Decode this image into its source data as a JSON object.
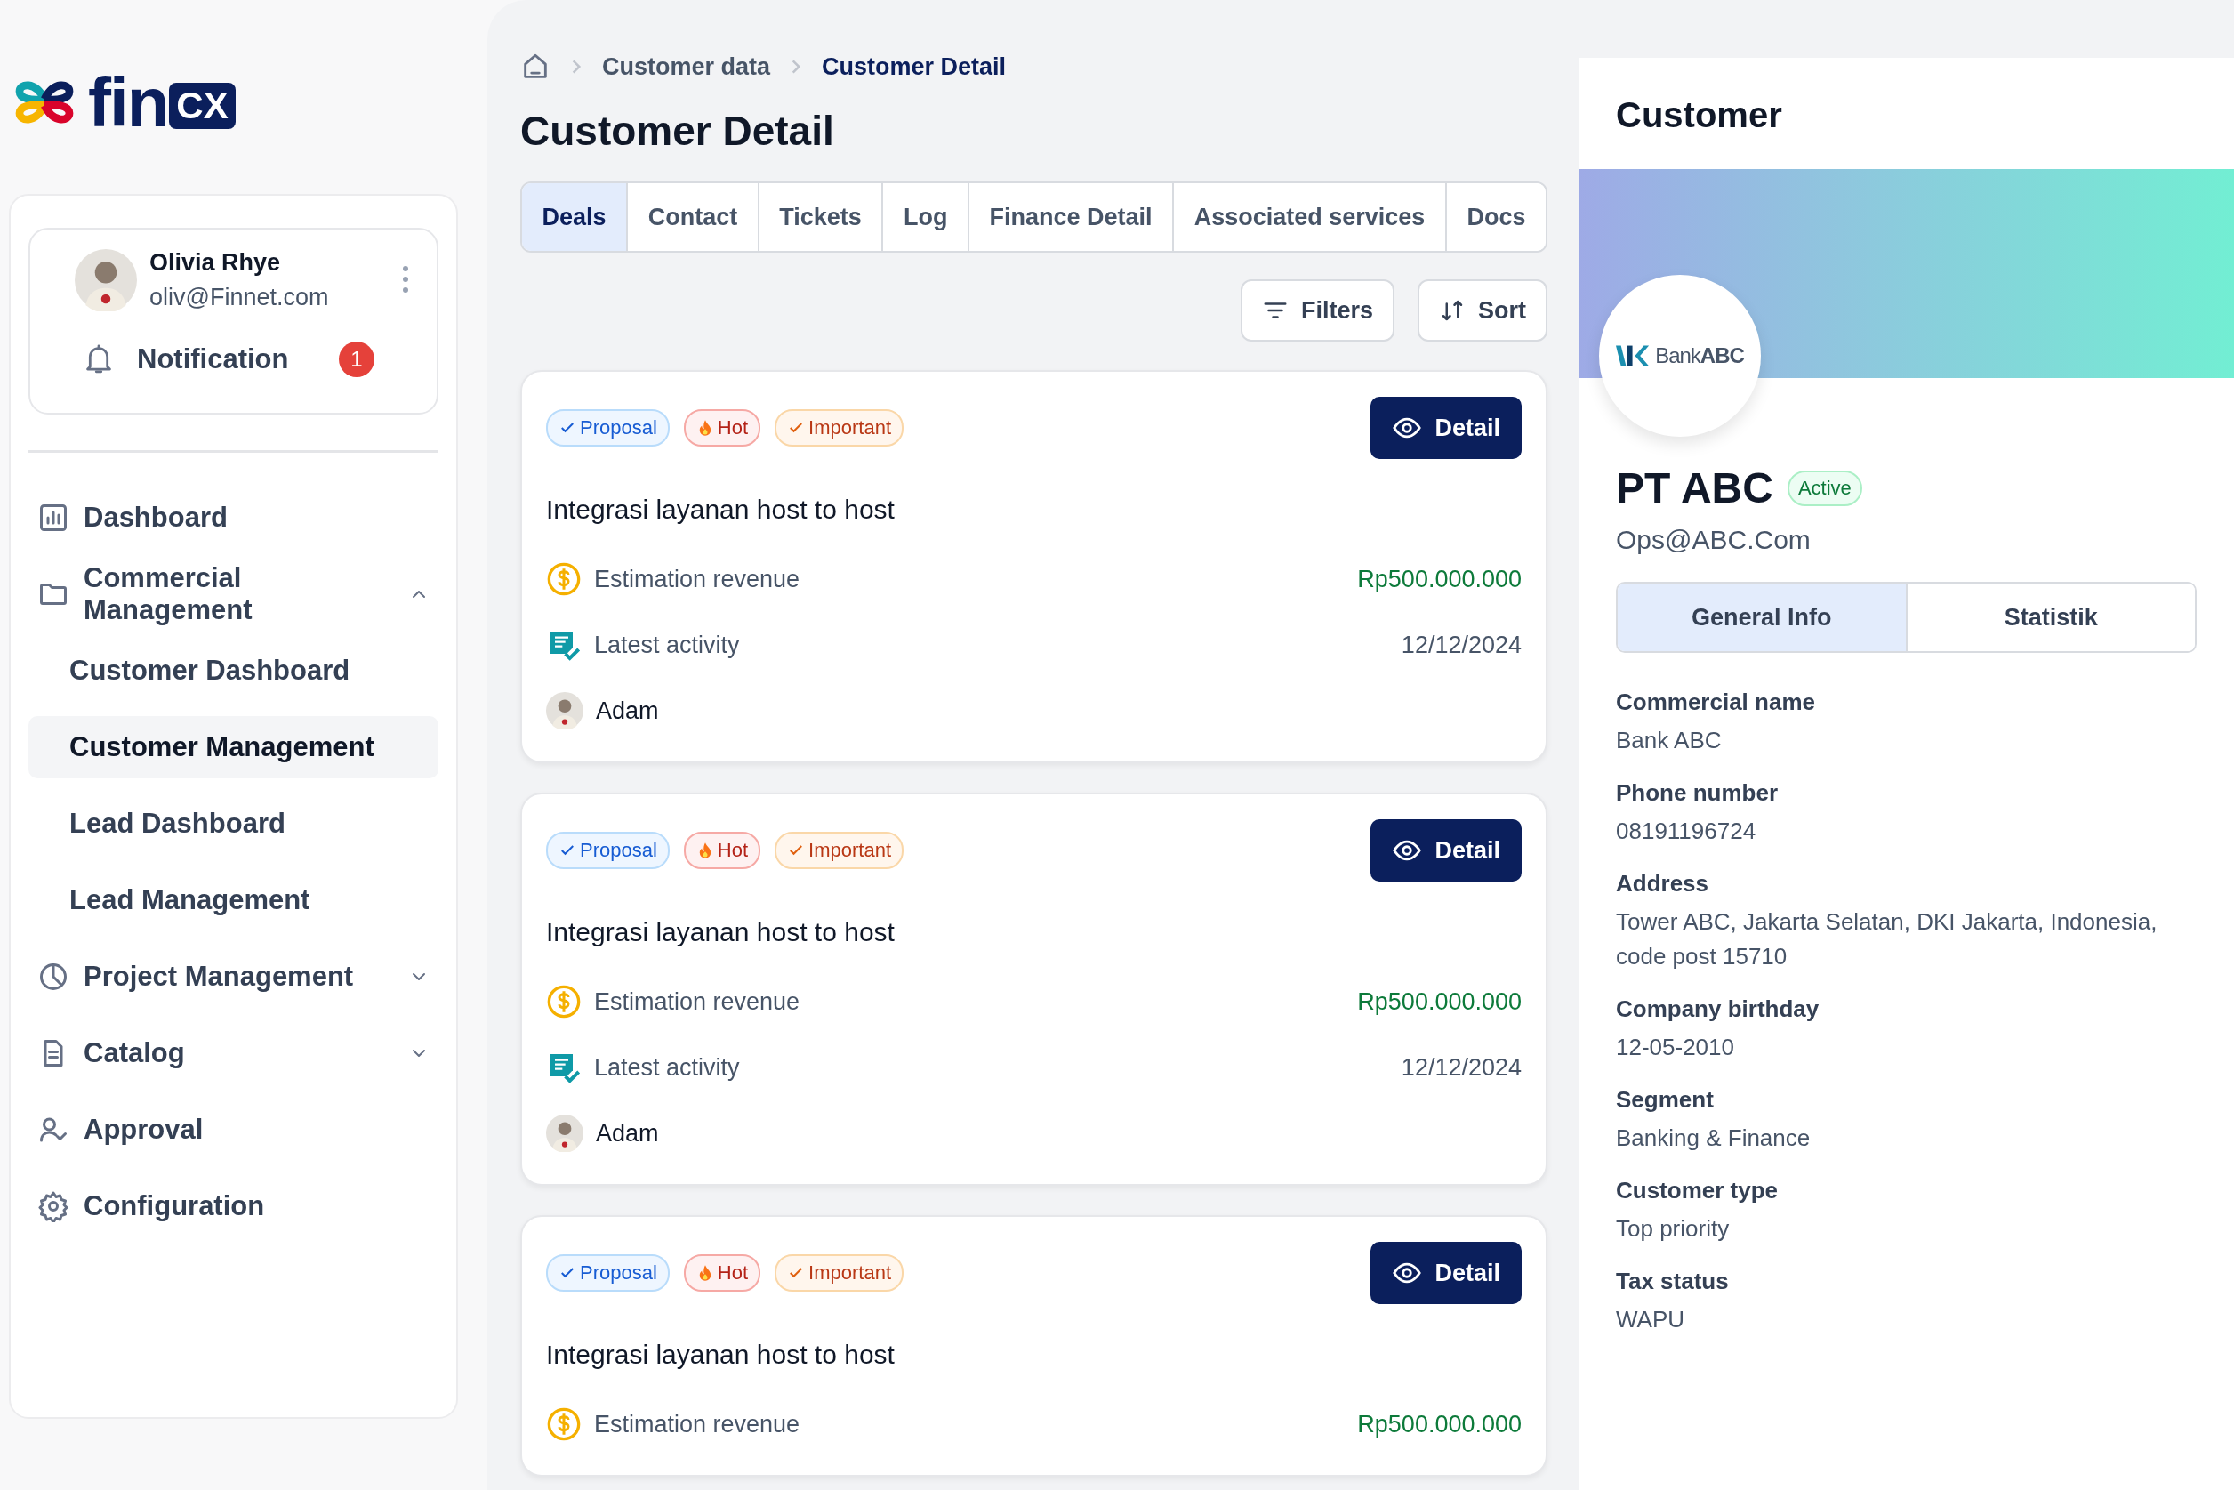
{
  "logo": {
    "text": "fin",
    "badge": "CX"
  },
  "user": {
    "name": "Olivia Rhye",
    "email": "oliv@Finnet.com"
  },
  "notification": {
    "label": "Notification",
    "count": "1"
  },
  "nav": [
    {
      "label": "Dashboard",
      "selected": false
    },
    {
      "label": "Commercial Management",
      "selected": false,
      "expanded": true,
      "children": [
        {
          "label": "Customer Dashboard",
          "selected": false
        },
        {
          "label": "Customer Management",
          "selected": true
        },
        {
          "label": "Lead Dashboard",
          "selected": false
        },
        {
          "label": "Lead Management",
          "selected": false
        }
      ]
    },
    {
      "label": "Project Management",
      "selected": false,
      "expanded": false
    },
    {
      "label": "Catalog",
      "selected": false,
      "expanded": false
    },
    {
      "label": "Approval",
      "selected": false
    },
    {
      "label": "Configuration",
      "selected": false
    }
  ],
  "breadcrumb": [
    {
      "label": "Customer data",
      "current": false
    },
    {
      "label": "Customer Detail",
      "current": true
    }
  ],
  "title": "Customer Detail",
  "tabs": [
    {
      "label": "Deals",
      "selected": true
    },
    {
      "label": "Contact",
      "selected": false
    },
    {
      "label": "Tickets",
      "selected": false
    },
    {
      "label": "Log",
      "selected": false
    },
    {
      "label": "Finance Detail",
      "selected": false
    },
    {
      "label": "Associated services",
      "selected": false
    },
    {
      "label": "Docs",
      "selected": false
    }
  ],
  "toolbar": [
    {
      "kind": "filter",
      "label": "Filters"
    },
    {
      "kind": "sort",
      "label": "Sort"
    }
  ],
  "deals": [
    {
      "tags": [
        {
          "kind": "proposal",
          "label": "Proposal"
        },
        {
          "kind": "hot",
          "label": "Hot"
        },
        {
          "kind": "important",
          "label": "Important"
        }
      ],
      "action": "Detail",
      "title": "Integrasi layanan host to host",
      "revenue_label": "Estimation revenue",
      "revenue": "Rp500.000.000",
      "activity_label": "Latest activity",
      "activity_date": "12/12/2024",
      "owner": "Adam"
    },
    {
      "tags": [
        {
          "kind": "proposal",
          "label": "Proposal"
        },
        {
          "kind": "hot",
          "label": "Hot"
        },
        {
          "kind": "important",
          "label": "Important"
        }
      ],
      "action": "Detail",
      "title": "Integrasi layanan host to host",
      "revenue_label": "Estimation revenue",
      "revenue": "Rp500.000.000",
      "activity_label": "Latest activity",
      "activity_date": "12/12/2024",
      "owner": "Adam"
    },
    {
      "tags": [
        {
          "kind": "proposal",
          "label": "Proposal"
        },
        {
          "kind": "hot",
          "label": "Hot"
        },
        {
          "kind": "important",
          "label": "Important"
        }
      ],
      "action": "Detail",
      "title": "Integrasi layanan host to host",
      "revenue_label": "Estimation revenue",
      "revenue": "Rp500.000.000"
    }
  ],
  "panel": {
    "title": "Customer",
    "logo_text": "Bank**ABC**",
    "name": "PT ABC",
    "status": "Active",
    "email": "Ops@ABC.Com",
    "tabs": [
      {
        "label": "General Info",
        "selected": true
      },
      {
        "label": "Statistik",
        "selected": false
      }
    ],
    "fields": [
      {
        "label": "Commercial name",
        "value": "Bank ABC"
      },
      {
        "label": "Phone number",
        "value": "08191196724"
      },
      {
        "label": "Address",
        "value": "Tower ABC, Jakarta Selatan, DKI Jakarta, Indonesia, code post 15710"
      },
      {
        "label": "Company birthday",
        "value": "12-05-2010"
      },
      {
        "label": "Segment",
        "value": "Banking & Finance"
      },
      {
        "label": "Customer type",
        "value": "Top priority"
      },
      {
        "label": "Tax status",
        "value": "WAPU"
      }
    ]
  }
}
